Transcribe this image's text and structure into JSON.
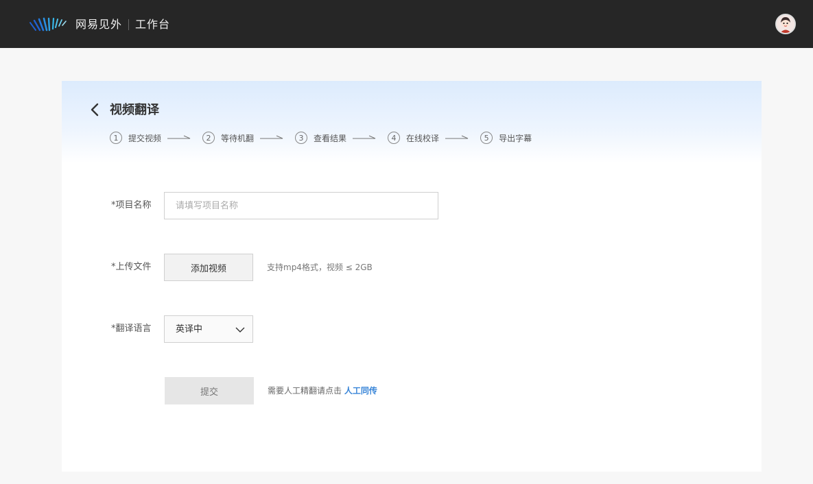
{
  "header": {
    "brand": "网易见外",
    "workspace": "工作台",
    "logo_icon": "wave-logo-icon",
    "avatar_icon": "user-avatar-icon"
  },
  "page": {
    "title": "视频翻译",
    "back_icon": "chevron-left-icon"
  },
  "steps": [
    {
      "num": "1",
      "label": "提交视频"
    },
    {
      "num": "2",
      "label": "等待机翻"
    },
    {
      "num": "3",
      "label": "查看结果"
    },
    {
      "num": "4",
      "label": "在线校译"
    },
    {
      "num": "5",
      "label": "导出字幕"
    }
  ],
  "form": {
    "project_label": "*项目名称",
    "project_placeholder": "请填写项目名称",
    "project_value": "",
    "upload_label": "*上传文件",
    "add_video_label": "添加视频",
    "upload_hint": "支持mp4格式，视频 ≤ 2GB",
    "language_label": "*翻译语言",
    "language_value": "英译中",
    "submit_label": "提交",
    "submit_hint": "需要人工精翻请点击",
    "human_link": "人工同传"
  },
  "colors": {
    "topbar": "#262626",
    "accent": "#3a86d8",
    "logo_dark": "#1f5fd0",
    "logo_light": "#35b6e8"
  }
}
